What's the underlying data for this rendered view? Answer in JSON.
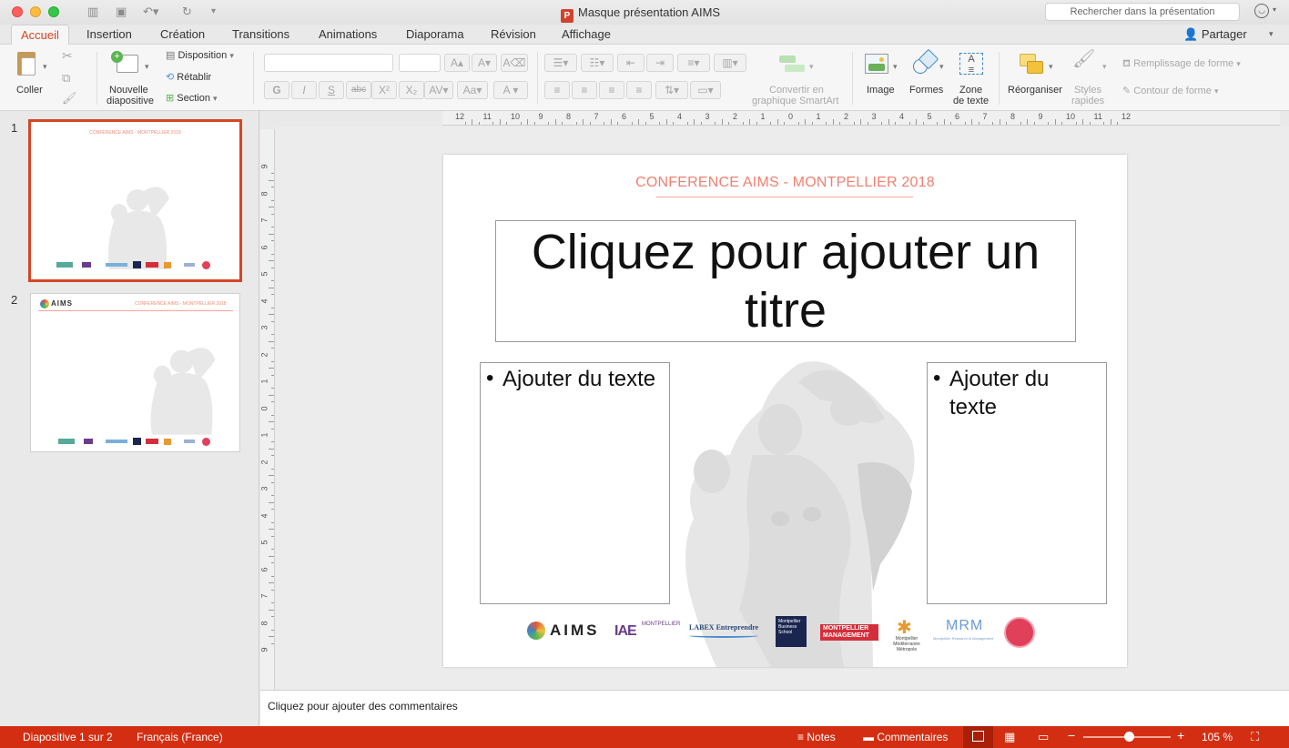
{
  "window": {
    "title": "Masque présentation AIMS",
    "search_placeholder": "Rechercher dans la présentation"
  },
  "tabs": [
    "Accueil",
    "Insertion",
    "Création",
    "Transitions",
    "Animations",
    "Diaporama",
    "Révision",
    "Affichage"
  ],
  "share_label": "Partager",
  "ribbon": {
    "paste": "Coller",
    "new_slide_1": "Nouvelle",
    "new_slide_2": "diapositive",
    "layout": "Disposition",
    "reset": "Rétablir",
    "section": "Section",
    "bold": "G",
    "italic": "I",
    "underline": "S",
    "strike": "abc",
    "superscript": "X²",
    "subscript": "X₂",
    "convert_1": "Convertir en",
    "convert_2": "graphique SmartArt",
    "image": "Image",
    "shapes": "Formes",
    "textbox_1": "Zone",
    "textbox_2": "de texte",
    "arrange": "Réorganiser",
    "quick_styles_1": "Styles",
    "quick_styles_2": "rapides",
    "shape_fill": "Remplissage de forme",
    "shape_outline": "Contour de forme"
  },
  "thumbnails": [
    {
      "number": "1",
      "header": "CONFERENCE AIMS - MONTPELLIER 2018"
    },
    {
      "number": "2",
      "header": "CONFERENCE AIMS - MONTPELLIER 2018",
      "logo_text": "AIMS"
    }
  ],
  "ruler": {
    "horizontal_labels": [
      "12",
      "11",
      "10",
      "9",
      "8",
      "7",
      "6",
      "5",
      "4",
      "3",
      "2",
      "1",
      "0",
      "1",
      "2",
      "3",
      "4",
      "5",
      "6",
      "7",
      "8",
      "9",
      "10",
      "11",
      "12"
    ],
    "vertical_labels": [
      "9",
      "8",
      "7",
      "6",
      "5",
      "4",
      "3",
      "2",
      "1",
      "0",
      "1",
      "2",
      "3",
      "4",
      "5",
      "6",
      "7",
      "8",
      "9"
    ]
  },
  "slide": {
    "header": "CONFERENCE AIMS - MONTPELLIER 2018",
    "title_placeholder": "Cliquez pour ajouter un titre",
    "left_text": "Ajouter du texte",
    "right_text": "Ajouter du texte",
    "bullet": "•",
    "logos": {
      "aims": "AIMS",
      "iae": "IAE",
      "iae_sub": "MONTPELLIER",
      "labex": "LABEX Entreprendre",
      "mbs": "Montpellier Business School",
      "mm": "MONTPELLIER MANAGEMENT",
      "metro": "Montpellier Méditerranée Métropole",
      "mrm": "MRM",
      "mrm_sub": "Montpellier Research in Management"
    }
  },
  "notes_placeholder": "Cliquez pour ajouter des commentaires",
  "status": {
    "slide_counter": "Diapositive 1 sur 2",
    "language": "Français (France)",
    "notes": "Notes",
    "comments": "Commentaires",
    "zoom": "105 %",
    "zoom_minus": "−",
    "zoom_plus": "+",
    "zoom_level": 0.52
  },
  "colors": {
    "accent": "#d24726",
    "status_bar": "#d42e12",
    "slide_header": "#f08070"
  }
}
